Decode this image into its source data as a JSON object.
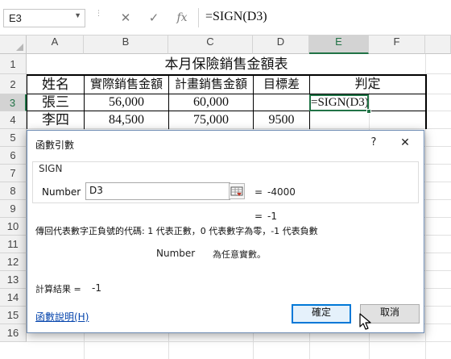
{
  "formula_bar": {
    "name_box": "E3",
    "cancel_glyph": "✕",
    "enter_glyph": "✓",
    "fx_glyph": "fx",
    "formula": "=SIGN(D3)"
  },
  "columns": [
    "A",
    "B",
    "C",
    "D",
    "E",
    "F"
  ],
  "rows": [
    "1",
    "2",
    "3",
    "4",
    "5",
    "6",
    "7",
    "8",
    "9",
    "10",
    "11",
    "12",
    "13",
    "14",
    "15",
    "16"
  ],
  "sheet": {
    "title": "本月保險銷售金額表",
    "headers": [
      "姓名",
      "實際銷售金額",
      "計畫銷售金額",
      "目標差",
      "判定"
    ],
    "data": [
      {
        "name": "張三",
        "actual": "56,000",
        "plan": "60,000",
        "diff": "",
        "judge": "=SIGN(D3)"
      },
      {
        "name": "李四",
        "actual": "84,500",
        "plan": "75,000",
        "diff": "9500",
        "judge": ""
      }
    ]
  },
  "dialog": {
    "title": "函數引數",
    "help_glyph": "?",
    "close_glyph": "✕",
    "function_name": "SIGN",
    "arg_label": "Number",
    "arg_value": "D3",
    "arg_eq": "=",
    "arg_result": "-4000",
    "result_eq": "=",
    "result": "-1",
    "description": "傳回代表數字正負號的代碼: 1 代表正數，0 代表數字為零，-1 代表負數",
    "arg_help_name": "Number",
    "arg_help_text": "為任意實數。",
    "calc_label": "計算結果 =",
    "calc_value": "-1",
    "help_link": "函數說明(H)",
    "ok_label": "確定",
    "cancel_label": "取消"
  },
  "colors": {
    "accent_green": "#217346",
    "dialog_border": "#6d8bb3",
    "link": "#0645ad"
  }
}
